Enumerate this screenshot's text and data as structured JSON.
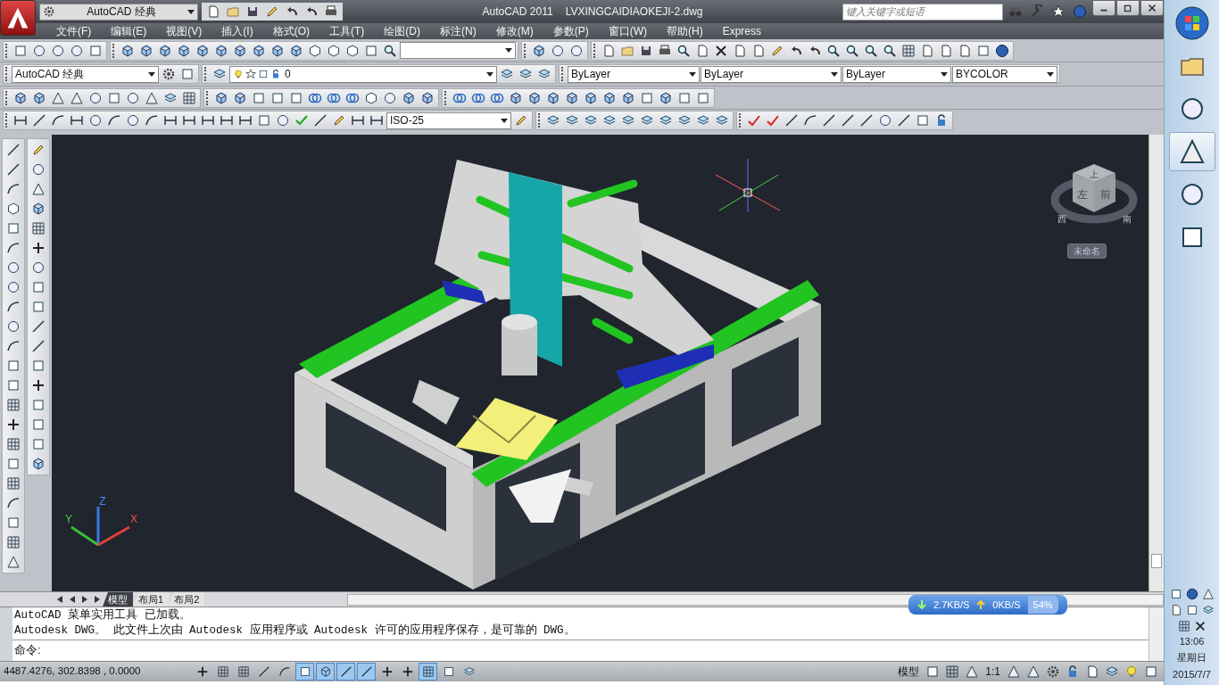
{
  "title_bar": {
    "workspace": "AutoCAD 经典",
    "title": "AutoCAD 2011",
    "filename": "LVXINGCAIDIAOKEJI-2.dwg",
    "search": {
      "placeholder": "键入关键字或短语"
    }
  },
  "menu": [
    "文件(F)",
    "编辑(E)",
    "视图(V)",
    "插入(I)",
    "格式(O)",
    "工具(T)",
    "绘图(D)",
    "标注(N)",
    "修改(M)",
    "参数(P)",
    "窗口(W)",
    "帮助(H)",
    "Express"
  ],
  "toolbars": {
    "workspace": "AutoCAD 经典",
    "layer": "0",
    "color_control": "ByLayer",
    "linetype": "ByLayer",
    "lineweight": "ByLayer",
    "plot_style": "BYCOLOR",
    "dim_style": "ISO-25"
  },
  "viewport": {
    "viewcube": {
      "top": "上",
      "left": "左",
      "front": "前",
      "west": "西",
      "south": "南",
      "view_name": "未命名"
    },
    "ucs": {
      "x": "X",
      "y": "Y",
      "z": "Z"
    }
  },
  "layout_tabs": [
    {
      "label": "模型",
      "selected": true
    },
    {
      "label": "布局1",
      "selected": false
    },
    {
      "label": "布局2",
      "selected": false
    }
  ],
  "net_monitor": {
    "down": "2.7KB/S",
    "up": "0KB/S",
    "percent": "54%"
  },
  "command": {
    "history": [
      "AutoCAD 菜单实用工具 已加载。",
      "Autodesk DWG。  此文件上次由 Autodesk 应用程序或 Autodesk 许可的应用程序保存，是可靠的 DWG。"
    ],
    "prompt": "命令:"
  },
  "status_bar": {
    "coords": "4487.4276,  302.8398 , 0.0000",
    "toggles": [
      {
        "on": false
      },
      {
        "on": false
      },
      {
        "on": false
      },
      {
        "on": false
      },
      {
        "on": false
      },
      {
        "on": true
      },
      {
        "on": true
      },
      {
        "on": true
      },
      {
        "on": true
      },
      {
        "on": false
      },
      {
        "on": false
      },
      {
        "on": true
      },
      {
        "on": false
      },
      {
        "on": false
      }
    ],
    "model": "模型",
    "scale": "1:1"
  },
  "taskbar": {
    "time": "13:06",
    "day": "星期日",
    "date": "2015/7/7"
  }
}
